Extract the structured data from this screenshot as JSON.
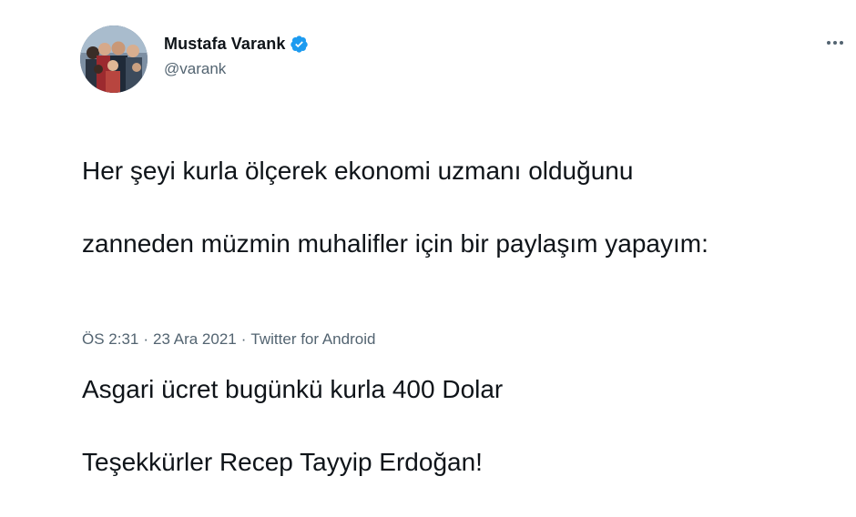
{
  "author": {
    "name": "Mustafa Varank",
    "handle": "@varank",
    "verified_color": "#1d9bf0",
    "avatar_icon": "profile-photo-group"
  },
  "tweet": {
    "lines": [
      "Her şeyi kurla ölçerek ekonomi uzmanı olduğunu",
      "zanneden müzmin muhalifler için bir paylaşım yapayım:",
      "",
      "Asgari ücret bugünkü kurla 400 Dolar",
      "Teşekkürler Recep Tayyip Erdoğan!"
    ]
  },
  "meta": {
    "time": "ÖS 2:31",
    "date": "23 Ara 2021",
    "source": "Twitter for Android",
    "separator": "·"
  },
  "menu": {
    "more_icon": "more-horizontal-icon"
  },
  "colors": {
    "text_primary": "#0f1419",
    "text_secondary": "#536471",
    "brand": "#1d9bf0"
  }
}
